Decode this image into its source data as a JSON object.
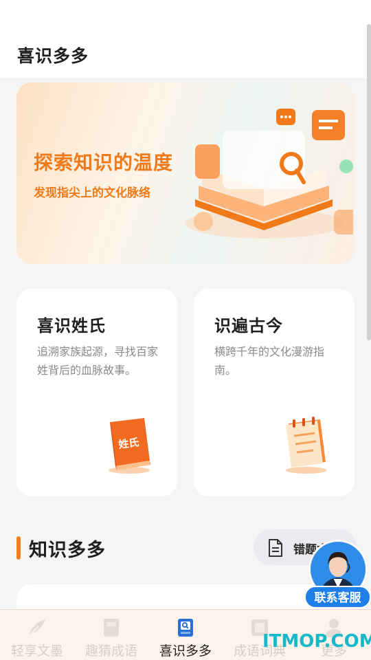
{
  "header": {
    "title": "喜识多多"
  },
  "banner": {
    "headline": "探索知识的温度",
    "subline": "发现指尖上的文化脉络",
    "art_icon": "open-book-magnifier-icon"
  },
  "cards": [
    {
      "title": "喜识姓氏",
      "desc": "追溯家族起源，寻找百家姓背后的血脉故事。",
      "icon": "surname-book-icon",
      "icon_text": "姓氏"
    },
    {
      "title": "识遍古今",
      "desc": "横跨千年的文化漫游指南。",
      "icon": "notepad-icon"
    }
  ],
  "section": {
    "title": "知识多多",
    "wrong_button": {
      "label": "错题本",
      "icon": "document-icon"
    }
  },
  "service": {
    "label": "联系客服",
    "icon": "customer-service-avatar"
  },
  "tabs": [
    {
      "label": "轻享文墨",
      "icon": "feather-icon",
      "active": false
    },
    {
      "label": "趣猜成语",
      "icon": "idiom-book-icon",
      "active": false
    },
    {
      "label": "喜识多多",
      "icon": "book-search-icon",
      "active": true
    },
    {
      "label": "成语词典",
      "icon": "dictionary-icon",
      "active": false
    },
    {
      "label": "更多",
      "icon": "user-icon",
      "active": false
    }
  ],
  "watermark": "ITMOP.COM",
  "colors": {
    "accent": "#f27f1e",
    "active_tab": "#2b6fd6",
    "service_blue": "#1f7fe8"
  }
}
